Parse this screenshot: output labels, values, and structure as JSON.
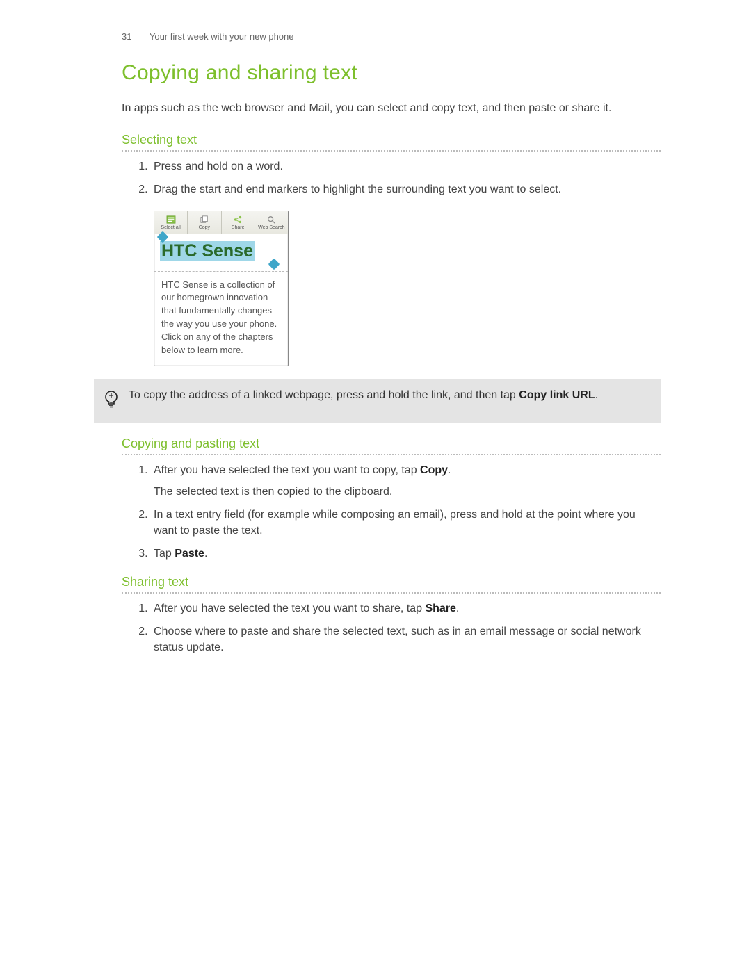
{
  "header": {
    "page_number": "31",
    "breadcrumb": "Your first week with your new phone"
  },
  "title": "Copying and sharing text",
  "intro": "In apps such as the web browser and Mail, you can select and copy text, and then paste or share it.",
  "sections": {
    "selecting": {
      "heading": "Selecting text",
      "step1": "Press and hold on a word.",
      "step2": "Drag the start and end markers to highlight the surrounding text you want to select."
    },
    "copying": {
      "heading": "Copying and pasting text",
      "step1_a": "After you have selected the text you want to copy, tap ",
      "step1_b": "Copy",
      "step1_c": ".",
      "step1_sub": "The selected text is then copied to the clipboard.",
      "step2": "In a text entry field (for example while composing an email), press and hold at the point where you want to paste the text.",
      "step3_a": "Tap ",
      "step3_b": "Paste",
      "step3_c": "."
    },
    "sharing": {
      "heading": "Sharing text",
      "step1_a": "After you have selected the text you want to share, tap ",
      "step1_b": "Share",
      "step1_c": ".",
      "step2": "Choose where to paste and share the selected text, such as in an email message or social network status update."
    }
  },
  "mock": {
    "toolbar": {
      "select_all": "Select all",
      "copy": "Copy",
      "share": "Share",
      "web_search": "Web Search"
    },
    "highlight": "HTC Sense",
    "body": "HTC Sense is a collection of our homegrown innovation that fundamentally changes the way you use your phone. Click on any of the chapters below to learn more."
  },
  "tip": {
    "text_a": "To copy the address of a linked webpage, press and hold the link, and then tap ",
    "text_b": "Copy link URL",
    "text_c": "."
  }
}
